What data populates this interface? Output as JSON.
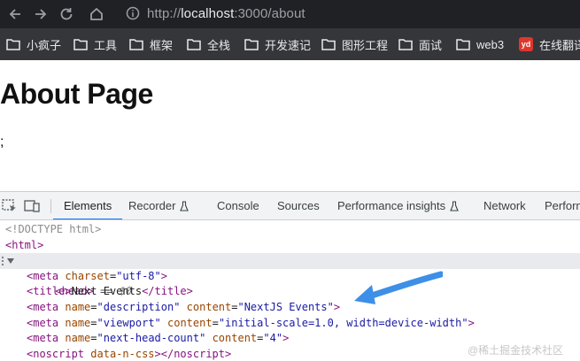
{
  "browser": {
    "url_scheme": "http://",
    "url_host": "localhost",
    "url_path": ":3000/about"
  },
  "bookmarks": [
    {
      "label": "小疯子",
      "icon": "folder-icon"
    },
    {
      "label": "工具",
      "icon": "folder-icon"
    },
    {
      "label": "框架",
      "icon": "folder-icon"
    },
    {
      "label": "全栈",
      "icon": "folder-icon"
    },
    {
      "label": "开发速记",
      "icon": "folder-icon"
    },
    {
      "label": "图形工程",
      "icon": "folder-icon"
    },
    {
      "label": "面试",
      "icon": "folder-icon"
    },
    {
      "label": "web3",
      "icon": "folder-icon"
    },
    {
      "label": "在线翻译",
      "icon": "youdao-icon",
      "badge": "yd"
    }
  ],
  "page": {
    "title": "About Page",
    "text": ";"
  },
  "devtools": {
    "tabs": [
      {
        "label": "Elements",
        "active": true
      },
      {
        "label": "Recorder",
        "experimental": true
      },
      {
        "label": "Console"
      },
      {
        "label": "Sources"
      },
      {
        "label": "Performance insights",
        "experimental": true
      },
      {
        "label": "Network"
      },
      {
        "label": "Performance"
      }
    ],
    "dom": {
      "doctype": "<!DOCTYPE html>",
      "html_tag": "html",
      "head_tag": "head",
      "selected_marker": " == ",
      "selected_ref": "$0",
      "meta1": {
        "tag": "meta",
        "attr": "charset",
        "value": "\"utf-8\""
      },
      "title": {
        "tag": "title",
        "text": "Next Events"
      },
      "meta2": {
        "tag": "meta",
        "attr1": "name",
        "val1": "\"description\"",
        "attr2": "content",
        "val2": "\"NextJS Events\""
      },
      "meta3": {
        "tag": "meta",
        "attr1": "name",
        "val1": "\"viewport\"",
        "attr2": "content",
        "val2": "\"initial-scale=1.0, width=device-width\""
      },
      "meta4": {
        "tag": "meta",
        "attr1": "name",
        "val1": "\"next-head-count\"",
        "attr2": "content",
        "val2": "\"4\""
      },
      "noscript": {
        "tag": "noscript",
        "attr": "data-n-css"
      }
    }
  },
  "colors": {
    "arrow": "#3d8fe8",
    "accent": "#1a73e8"
  },
  "watermark": "@稀土掘金技术社区"
}
